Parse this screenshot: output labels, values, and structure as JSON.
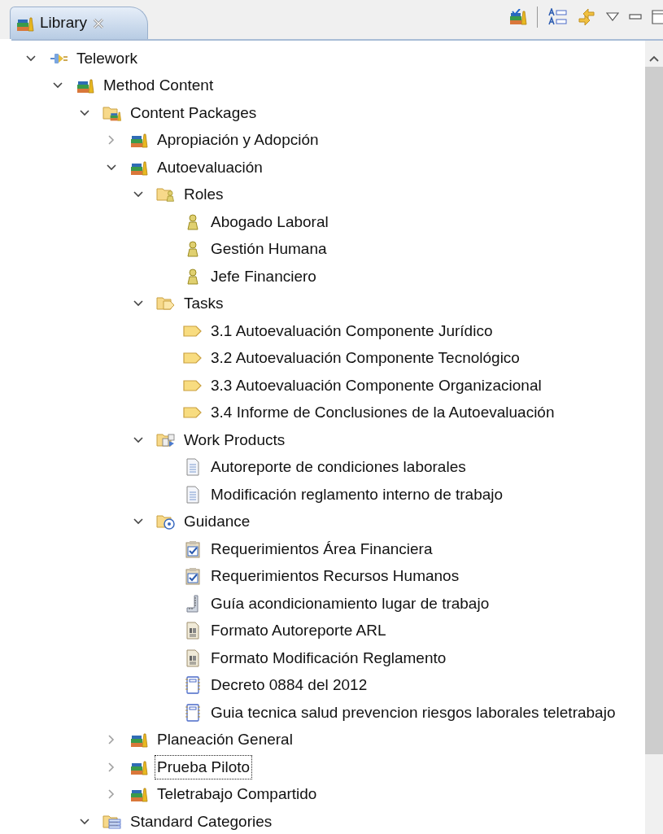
{
  "tab": {
    "label": "Library",
    "selected": true
  },
  "tree": [
    {
      "label": "Telework",
      "kind": "project",
      "expanded": true,
      "focused": false,
      "children": [
        {
          "label": "Method Content",
          "kind": "library",
          "expanded": true,
          "focused": false,
          "children": [
            {
              "label": "Content Packages",
              "kind": "packages",
              "expanded": true,
              "focused": false,
              "children": [
                {
                  "label": "Apropiación y Adopción",
                  "kind": "library",
                  "expanded": false,
                  "focused": false
                },
                {
                  "label": "Autoevaluación",
                  "kind": "library",
                  "expanded": true,
                  "focused": false,
                  "children": [
                    {
                      "label": "Roles",
                      "kind": "roles",
                      "expanded": true,
                      "focused": false,
                      "children": [
                        {
                          "label": "Abogado Laboral",
                          "kind": "role",
                          "focused": false
                        },
                        {
                          "label": "Gestión Humana",
                          "kind": "role",
                          "focused": false
                        },
                        {
                          "label": "Jefe Financiero",
                          "kind": "role",
                          "focused": false
                        }
                      ]
                    },
                    {
                      "label": "Tasks",
                      "kind": "tasks",
                      "expanded": true,
                      "focused": false,
                      "children": [
                        {
                          "label": "3.1 Autoevaluación Componente Jurídico",
                          "kind": "task",
                          "focused": false
                        },
                        {
                          "label": "3.2 Autoevaluación Componente Tecnológico",
                          "kind": "task",
                          "focused": false
                        },
                        {
                          "label": "3.3 Autoevaluación Componente Organizacional",
                          "kind": "task",
                          "focused": false
                        },
                        {
                          "label": "3.4 Informe de Conclusiones de la Autoevaluación",
                          "kind": "task",
                          "focused": false
                        }
                      ]
                    },
                    {
                      "label": "Work Products",
                      "kind": "workproducts",
                      "expanded": true,
                      "focused": false,
                      "children": [
                        {
                          "label": "Autoreporte de condiciones laborales",
                          "kind": "document",
                          "focused": false
                        },
                        {
                          "label": "Modificación reglamento interno de trabajo",
                          "kind": "document",
                          "focused": false
                        }
                      ]
                    },
                    {
                      "label": "Guidance",
                      "kind": "guidance",
                      "expanded": true,
                      "focused": false,
                      "children": [
                        {
                          "label": "Requerimientos Área Financiera",
                          "kind": "checklist",
                          "focused": false
                        },
                        {
                          "label": "Requerimientos Recursos Humanos",
                          "kind": "checklist",
                          "focused": false
                        },
                        {
                          "label": "Guía acondicionamiento lugar de trabajo",
                          "kind": "guideline",
                          "focused": false
                        },
                        {
                          "label": "Formato Autoreporte ARL",
                          "kind": "template",
                          "focused": false
                        },
                        {
                          "label": "Formato Modificación Reglamento",
                          "kind": "template",
                          "focused": false
                        },
                        {
                          "label": "Decreto 0884 del 2012",
                          "kind": "reference",
                          "focused": false
                        },
                        {
                          "label": "Guia tecnica salud prevencion riesgos laborales teletrabajo",
                          "kind": "reference",
                          "focused": false
                        }
                      ]
                    }
                  ]
                },
                {
                  "label": "Planeación General",
                  "kind": "library",
                  "expanded": false,
                  "focused": false
                },
                {
                  "label": "Prueba Piloto",
                  "kind": "library",
                  "expanded": false,
                  "focused": true
                },
                {
                  "label": "Teletrabajo Compartido",
                  "kind": "library",
                  "expanded": false,
                  "focused": false
                }
              ]
            },
            {
              "label": "Standard Categories",
              "kind": "categories",
              "expanded": true,
              "focused": false
            }
          ]
        }
      ]
    }
  ]
}
